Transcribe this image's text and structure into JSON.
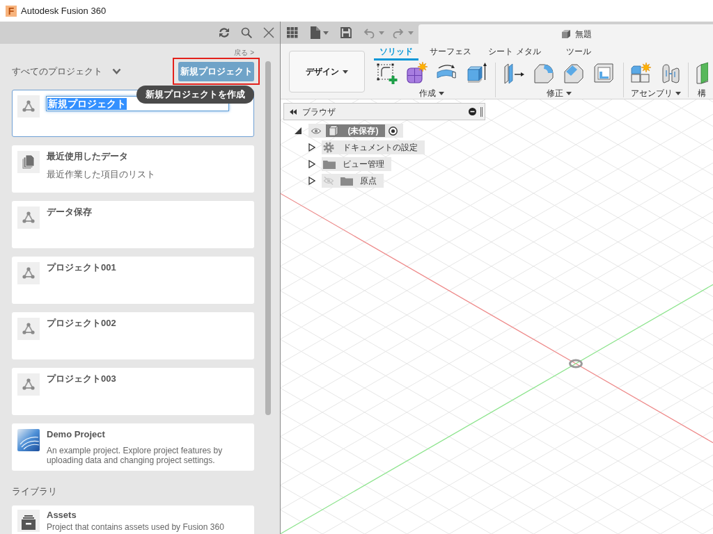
{
  "window": {
    "logo_letter": "F",
    "title": "Autodesk Fusion 360"
  },
  "data_panel": {
    "back_link": "戻る >",
    "filter": "すべてのプロジェクト",
    "new_project_button": {
      "label": "新規プロジェクト",
      "highlighted": true
    },
    "tooltip": "新規プロジェクトを作成",
    "projects": [
      {
        "kind": "editing",
        "value": "新規プロジェクト",
        "text_selected": true
      },
      {
        "kind": "recent",
        "title": "最近使用したデータ",
        "description": "最近作業した項目のリスト"
      },
      {
        "kind": "project",
        "title": "データ保存"
      },
      {
        "kind": "project",
        "title": "プロジェクト001"
      },
      {
        "kind": "project",
        "title": "プロジェクト002"
      },
      {
        "kind": "project",
        "title": "プロジェクト003"
      },
      {
        "kind": "demo",
        "title": "Demo Project",
        "description": "An example project. Explore project features by uploading data and changing project settings."
      }
    ],
    "library_heading": "ライブラリ",
    "library": [
      {
        "kind": "library",
        "title": "Assets",
        "description": "Project that contains assets used by Fusion 360"
      }
    ]
  },
  "quick_access": {
    "undo": {
      "disabled": true
    },
    "redo": {
      "disabled": true
    }
  },
  "document_tab": {
    "title": "無題"
  },
  "toolbar": {
    "workspace": "デザイン",
    "tabs": [
      {
        "label": "ソリッド",
        "selected": true
      },
      {
        "label": "サーフェス",
        "selected": false
      },
      {
        "label": "シート メタル",
        "selected": false
      },
      {
        "label": "ツール",
        "selected": false
      }
    ],
    "groups": [
      {
        "label": "作成",
        "dropdown": true
      },
      {
        "label": "修正",
        "dropdown": true
      },
      {
        "label": "アセンブリ",
        "dropdown": true
      },
      {
        "label": "構",
        "dropdown": false
      }
    ]
  },
  "browser": {
    "title": "ブラウザ",
    "tree": [
      {
        "kind": "component",
        "label": "(未保存)",
        "expanded": true,
        "visible": true,
        "children": [
          {
            "kind": "settings",
            "label": "ドキュメントの設定",
            "expanded": false
          },
          {
            "kind": "folder",
            "label": "ビュー管理",
            "expanded": false
          },
          {
            "kind": "folder",
            "label": "原点",
            "expanded": false,
            "visible": false
          }
        ]
      }
    ]
  }
}
